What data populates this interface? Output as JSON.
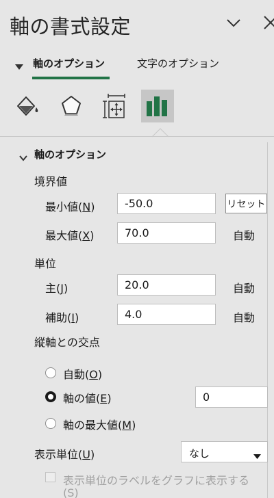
{
  "pane": {
    "title": "軸の書式設定",
    "collapse_icon": "chevron-down-icon",
    "close_icon": "close-icon"
  },
  "tabs": {
    "axis_options": "軸のオプション",
    "text_options": "文字のオプション"
  },
  "category_icons": [
    "fill-line-icon",
    "effects-pentagon-icon",
    "size-properties-icon",
    "axis-options-bar-chart-icon"
  ],
  "section": {
    "title": "軸のオプション",
    "bounds": {
      "heading": "境界値",
      "min": {
        "label": "最小値(",
        "key": "N",
        "close": ")",
        "value": "-50.0",
        "action": "リセット"
      },
      "max": {
        "label": "最大値(",
        "key": "X",
        "close": ")",
        "value": "70.0",
        "action": "自動"
      }
    },
    "units": {
      "heading": "単位",
      "major": {
        "label": "主(",
        "key": "J",
        "close": ")",
        "value": "20.0",
        "action": "自動"
      },
      "minor": {
        "label": "補助(",
        "key": "I",
        "close": ")",
        "value": "4.0",
        "action": "自動"
      }
    },
    "crosses": {
      "heading": "縦軸との交点",
      "auto": {
        "label": "自動(",
        "key": "O",
        "close": ")"
      },
      "axis_value": {
        "label": "軸の値(",
        "key": "E",
        "close": ")",
        "value": "0"
      },
      "max_value": {
        "label": "軸の最大値(",
        "key": "M",
        "close": ")"
      }
    },
    "display_units": {
      "label": "表示単位(",
      "key": "U",
      "close": ")",
      "selected": "なし",
      "show_label": "表示単位のラベルをグラフに表示する",
      "show_label_key": "(S)"
    }
  },
  "colors": {
    "accent_green": "#217346",
    "pane_background": "#e6e6e6",
    "selected_icon_background": "#c6c6c6"
  }
}
